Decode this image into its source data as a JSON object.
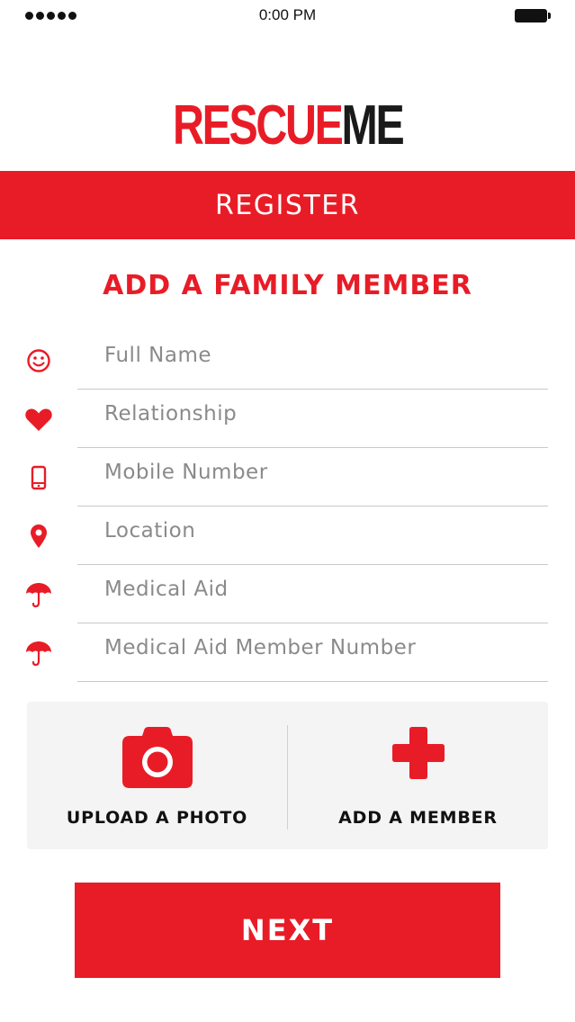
{
  "status_bar": {
    "time": "0:00 PM"
  },
  "logo": {
    "part1": "RESCUE",
    "part2": "ME"
  },
  "header": {
    "title": "REGISTER"
  },
  "form": {
    "title": "ADD A FAMILY MEMBER",
    "fields": [
      {
        "placeholder": "Full Name",
        "icon": "smiley-icon"
      },
      {
        "placeholder": "Relationship",
        "icon": "heart-icon"
      },
      {
        "placeholder": "Mobile Number",
        "icon": "mobile-phone-icon"
      },
      {
        "placeholder": "Location",
        "icon": "location-pin-icon"
      },
      {
        "placeholder": "Medical Aid",
        "icon": "umbrella-icon"
      },
      {
        "placeholder": "Medical Aid Member Number",
        "icon": "umbrella-icon"
      }
    ]
  },
  "actions": {
    "upload_label": "UPLOAD A PHOTO",
    "add_member_label": "ADD A MEMBER"
  },
  "next_button": {
    "label": "NEXT"
  },
  "colors": {
    "brand_red": "#e81c27",
    "dark": "#1a1a1a"
  }
}
